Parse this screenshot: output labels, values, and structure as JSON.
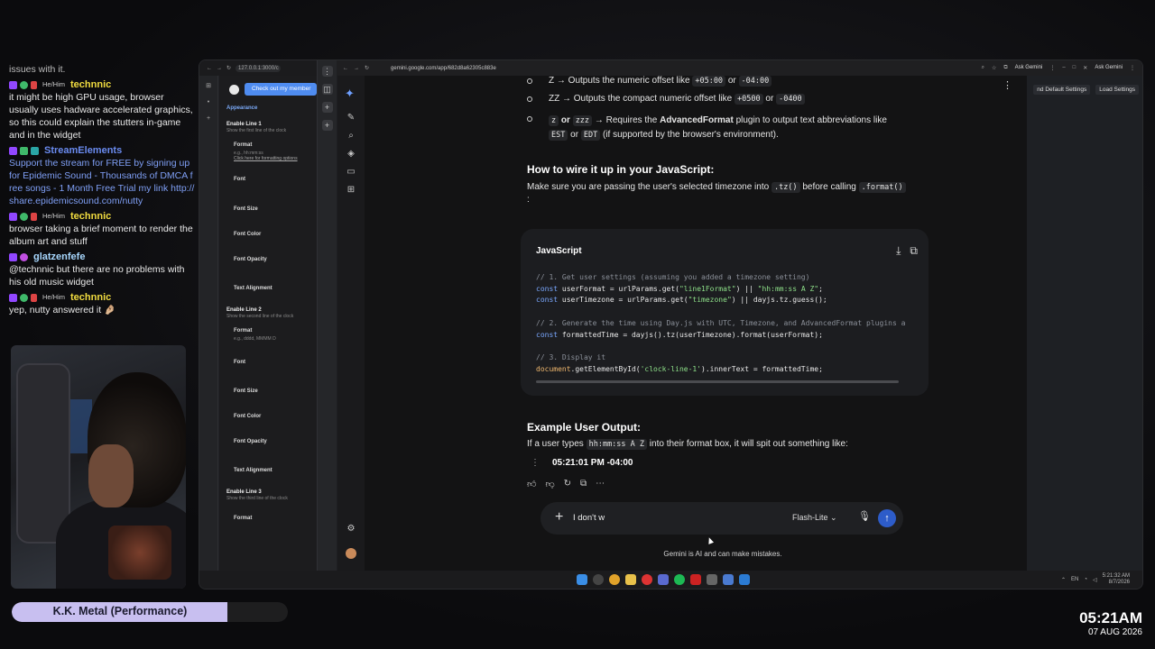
{
  "chat": {
    "top_text": "issues with it.",
    "messages": [
      {
        "pronoun": "He/Him",
        "user": "technnic",
        "text": "it might be high GPU usage, browser usually uses hadware accelerated graphics, so this could explain the stutters in-game and in the widget"
      },
      {
        "pronoun": "",
        "user": "StreamElements",
        "text": "Support the stream for FREE by signing up for Epidemic Sound - Thousands of DMCA free songs - 1 Month Free Trial my link http://share.epidemicsound.com/nutty"
      },
      {
        "pronoun": "He/Him",
        "user": "technnic",
        "text": "browser taking a brief moment to render the album art and stuff"
      },
      {
        "pronoun": "",
        "user": "glatzenfefe",
        "text": "@technnic but there are no problems with his old music widget"
      },
      {
        "pronoun": "He/Him",
        "user": "technnic",
        "text": "yep, nutty answered it 🤌🏼"
      }
    ]
  },
  "now_playing": {
    "title": "K.K. Metal (Performance)",
    "progress": 0.78
  },
  "stream_clock": {
    "time": "05:21AM",
    "date": "07 AUG 2026"
  },
  "left_browser": {
    "url": "127.0.0.1:3000/c",
    "member_button": "Check out my member",
    "settings": {
      "section": "Appearance",
      "line1_title": "Enable Line 1",
      "line1_hint": "Show the first line of the clock",
      "format_label": "Format",
      "format_placeholder_1": "e.g., hh:mm:ss",
      "format_link": "Click here for formatting options",
      "font_label": "Font",
      "font_size_label": "Font Size",
      "font_color_label": "Font Color",
      "font_opacity_label": "Font Opacity",
      "text_alignment_label": "Text Alignment",
      "line2_title": "Enable Line 2",
      "line2_hint": "Show the second line of the clock",
      "format_placeholder_2": "e.g., dddd, MMMM D",
      "line3_title": "Enable Line 3",
      "line3_hint": "Show the third line of the clock"
    }
  },
  "gemini": {
    "url": "gemini.google.com/app/682d8a62305c883e",
    "ask_label": "Ask Gemini",
    "right_buttons": [
      "nd Default Settings",
      "Load Settings"
    ],
    "bullets": [
      {
        "pre": "Z",
        "text": "→ Outputs the numeric offset like",
        "codes": [
          "+05:00",
          "-04:00"
        ],
        "joiner": "or"
      },
      {
        "pre": "ZZ",
        "text": "→ Outputs the compact numeric offset like",
        "codes": [
          "+0500",
          "-0400"
        ],
        "joiner": "or"
      },
      {
        "pre": "z",
        "pre2": "zzz",
        "joiner0": "or",
        "text": "→ Requires the",
        "bold": "AdvancedFormat",
        "text2": "plugin to output text abbreviations like",
        "codes": [
          "EST",
          "EDT"
        ],
        "joiner": "or",
        "text3": "(if supported by the browser's environment)."
      }
    ],
    "how_title": "How to wire it up in your JavaScript:",
    "how_text": "Make sure you are passing the user's selected timezone into",
    "how_code1": ".tz()",
    "how_text2": "before calling",
    "how_code2": ".format()",
    "how_colon": ":",
    "code": {
      "lang": "JavaScript",
      "c1": "// 1. Get user settings (assuming you added a timezone setting)",
      "c2": "// 2. Generate the time using Day.js with UTC, Timezone, and AdvancedFormat plugins a",
      "c3": "// 3. Display it"
    },
    "example_title": "Example User Output:",
    "example_text": "If a user types",
    "example_code": "hh:mm:ss A Z",
    "example_text2": "into their format box, it will spit out something like:",
    "output": "05:21:01 PM -04:00",
    "input_text": "I don't w",
    "model": "Flash-Lite",
    "disclaimer": "Gemini is AI and can make mistakes."
  },
  "taskbar": {
    "tray_lang": "EN",
    "tray_time": "5:21:32 AM",
    "tray_date": "8/7/2026"
  }
}
